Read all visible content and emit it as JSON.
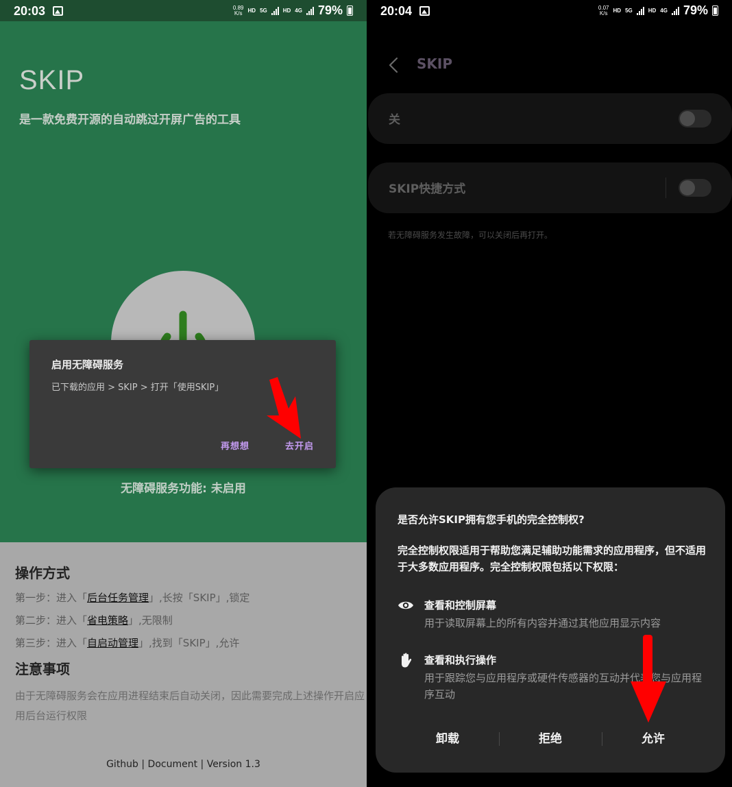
{
  "left": {
    "status": {
      "time": "20:03",
      "speed_top": "0.89",
      "speed_unit": "K/s",
      "hd1": "HD",
      "net1": "5G",
      "hd2": "HD",
      "net2": "4G",
      "battery": "79%"
    },
    "app_title": "SKIP",
    "app_subtitle": "是一款免费开源的自动跳过开屏广告的工具",
    "dialog": {
      "title": "启用无障碍服务",
      "message": "已下载的应用 > SKIP > 打开「使用SKIP」",
      "cancel_label": "再想想",
      "confirm_label": "去开启"
    },
    "service_status": "无障碍服务功能: 未启用",
    "howto_title": "操作方式",
    "steps": [
      {
        "prefix": "第一步：进入「",
        "link": "后台任务管理",
        "suffix": "」,长按「SKIP」,锁定"
      },
      {
        "prefix": "第二步：进入「",
        "link": "省电策略",
        "suffix": "」,无限制"
      },
      {
        "prefix": "第三步：进入「",
        "link": "自启动管理",
        "suffix": "」,找到「SKIP」,允许"
      }
    ],
    "notes_title": "注意事项",
    "notes_body": "由于无障碍服务会在应用进程结束后自动关闭，因此需要完成上述操作开启应用后台运行权限",
    "footer": "Github | Document | Version 1.3"
  },
  "right": {
    "status": {
      "time": "20:04",
      "speed_top": "0.07",
      "speed_unit": "K/s",
      "hd1": "HD",
      "net1": "5G",
      "hd2": "HD",
      "net2": "4G",
      "battery": "79%"
    },
    "page_title": "SKIP",
    "main_toggle_label": "关",
    "shortcut_label": "SKIP快捷方式",
    "hint": "若无障碍服务发生故障，可以关闭后再打开。",
    "sheet": {
      "title": "是否允许SKIP拥有您手机的完全控制权?",
      "description": "完全控制权限适用于帮助您满足辅助功能需求的应用程序，但不适用于大多数应用程序。完全控制权限包括以下权限：",
      "permissions": [
        {
          "icon": "eye-icon",
          "title": "查看和控制屏幕",
          "desc": "用于读取屏幕上的所有内容并通过其他应用显示内容"
        },
        {
          "icon": "hand-icon",
          "title": "查看和执行操作",
          "desc": "用于跟踪您与应用程序或硬件传感器的互动并代表您与应用程序互动"
        }
      ],
      "uninstall_label": "卸载",
      "deny_label": "拒绝",
      "allow_label": "允许"
    }
  },
  "colors": {
    "hero_green": "#26744a",
    "accent_purple": "#c39af0",
    "arrow_red": "#ff0000"
  }
}
